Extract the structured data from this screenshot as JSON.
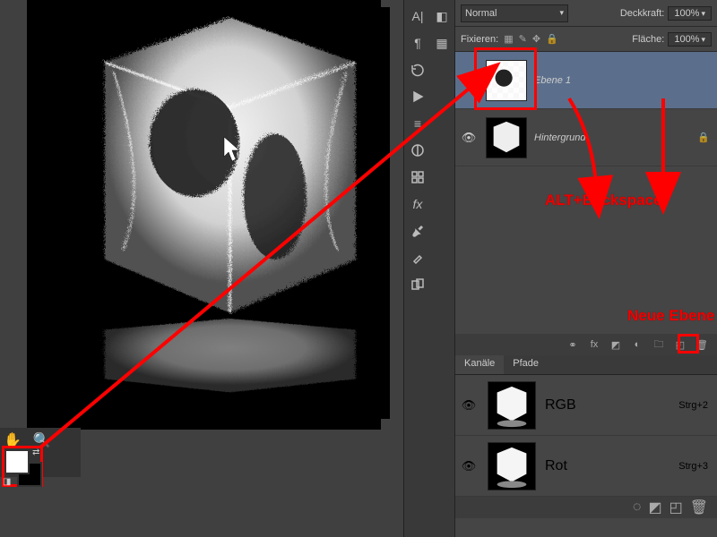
{
  "blend_mode": "Normal",
  "opacity_label": "Deckkraft:",
  "opacity_value": "100%",
  "fill_label": "Fläche:",
  "fill_value": "100%",
  "lock_label": "Fixieren:",
  "layers": [
    {
      "name": "Ebene 1",
      "visible": true,
      "locked": false,
      "selected": true
    },
    {
      "name": "Hintergrund",
      "visible": true,
      "locked": true,
      "selected": false
    }
  ],
  "footer_icons": {
    "link": "⚭",
    "fx": "fx",
    "mask": "◧",
    "adjust": "◑",
    "group": "▣",
    "new": "◰",
    "trash": "🗑"
  },
  "channels": {
    "tabs": [
      "Kanäle",
      "Pfade"
    ],
    "rows": [
      {
        "name": "RGB",
        "shortcut": "Strg+2",
        "visible": true
      },
      {
        "name": "Rot",
        "shortcut": "Strg+3",
        "visible": true
      }
    ]
  },
  "annotations": {
    "shortcut": "ALT+Backspace",
    "new_layer": "Neue Ebene"
  },
  "bottom_tools": {
    "hand": "✋",
    "zoom": "🔍"
  }
}
